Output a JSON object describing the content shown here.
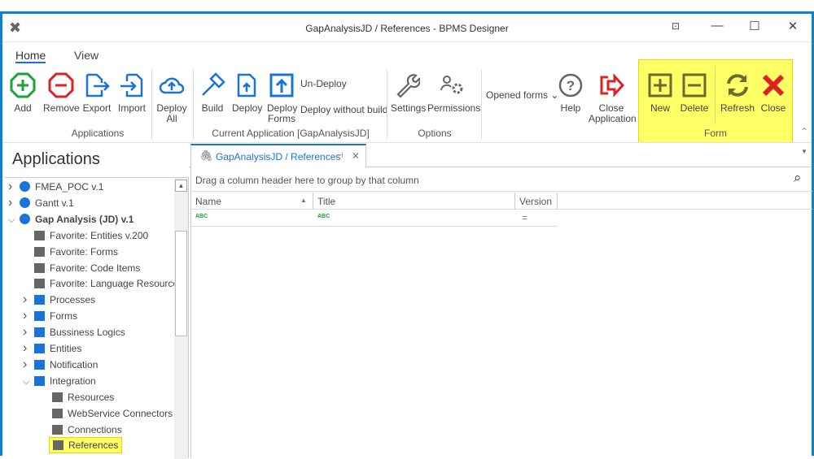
{
  "window": {
    "title": "GapAnalysisJD / References - BPMS Designer",
    "controls": [
      "restore",
      "minimize",
      "maximize",
      "close"
    ]
  },
  "ribbon": {
    "tabs": [
      "Home",
      "View"
    ],
    "applications": {
      "label": "Applications",
      "buttons": [
        "Add",
        "Remove",
        "Export",
        "Import"
      ],
      "deploy_all": [
        "Deploy",
        "All"
      ]
    },
    "current_app": {
      "label": "Current Application [GapAnalysisJD]",
      "build": "Build",
      "deploy": "Deploy",
      "deploy_forms": [
        "Deploy",
        "Forms"
      ],
      "undeploy": "Un-Deploy",
      "deploy_without_build": "Deploy without build"
    },
    "options": {
      "label": "Options",
      "settings": "Settings",
      "permissions": "Permissions"
    },
    "opened_forms": "Opened forms",
    "help": "Help",
    "close_app": [
      "Close",
      "Application"
    ],
    "form": {
      "label": "Form",
      "new": "New",
      "delete": "Delete",
      "refresh": "Refresh",
      "close": "Close"
    },
    "colors": {
      "highlight": "#ffff66",
      "accent": "#1a73d9",
      "green": "#1aa33a",
      "red": "#e02020",
      "olive": "#6b6b2e"
    }
  },
  "sidebar": {
    "title": "Applications",
    "items": [
      {
        "label": "FMEA_POC v.1",
        "level": 0,
        "expand": "collapsed",
        "icon": "circle"
      },
      {
        "label": "Gantt v.1",
        "level": 0,
        "expand": "collapsed",
        "icon": "circle"
      },
      {
        "label": "Gap Analysis (JD) v.1",
        "level": 0,
        "expand": "expanded",
        "icon": "circle",
        "bold": true
      },
      {
        "label": "Favorite: Entities v.200",
        "level": 1,
        "icon": "entities"
      },
      {
        "label": "Favorite: Forms",
        "level": 1,
        "icon": "forms"
      },
      {
        "label": "Favorite: Code Items",
        "level": 1,
        "icon": "code"
      },
      {
        "label": "Favorite: Language Resources",
        "level": 1,
        "icon": "language"
      },
      {
        "label": "Processes",
        "level": 1,
        "expand": "collapsed",
        "icon": "gears"
      },
      {
        "label": "Forms",
        "level": 1,
        "expand": "collapsed",
        "icon": "form"
      },
      {
        "label": "Bussiness Logics",
        "level": 1,
        "expand": "collapsed",
        "icon": "briefcase"
      },
      {
        "label": "Entities",
        "level": 1,
        "expand": "collapsed",
        "icon": "entities"
      },
      {
        "label": "Notification",
        "level": 1,
        "expand": "collapsed",
        "icon": "bell"
      },
      {
        "label": "Integration",
        "level": 1,
        "expand": "expanded",
        "icon": "handshake"
      },
      {
        "label": "Resources",
        "level": 2,
        "icon": "resources"
      },
      {
        "label": "WebService Connectors",
        "level": 2,
        "icon": "globe"
      },
      {
        "label": "Connections",
        "level": 2,
        "icon": "plug"
      },
      {
        "label": "References",
        "level": 2,
        "icon": "paperclip",
        "selected": true
      }
    ]
  },
  "document": {
    "tab_label": "GapAnalysisJD / References",
    "group_panel": "Drag a column header here to group by that column",
    "columns": [
      "Name",
      "Title",
      "Version"
    ],
    "filter_row": [
      "ABC",
      "ABC",
      "="
    ]
  }
}
